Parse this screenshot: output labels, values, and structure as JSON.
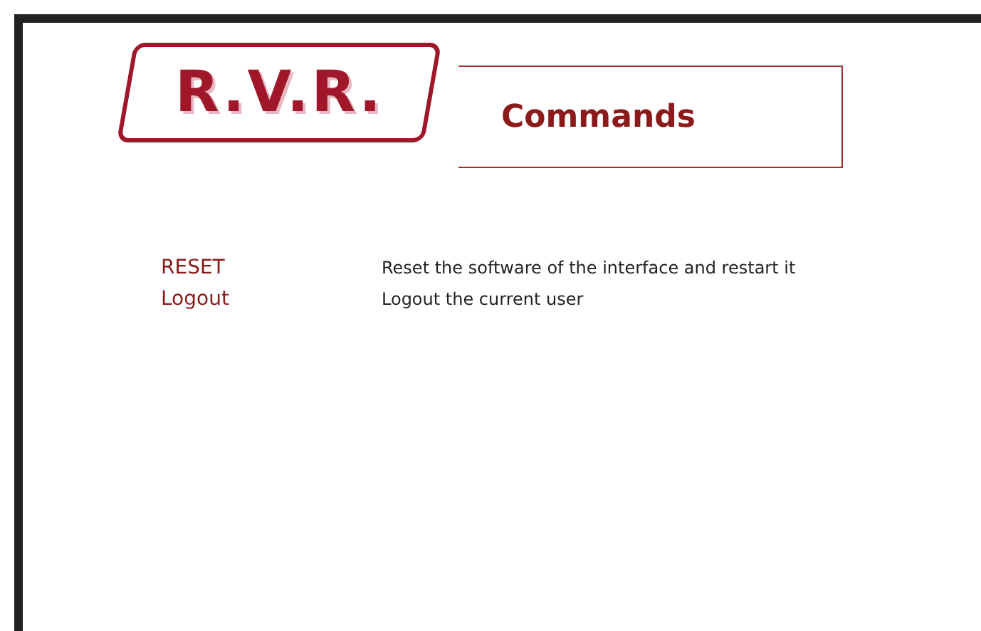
{
  "logo": {
    "text": "R.V.R."
  },
  "header": {
    "title": "Commands"
  },
  "commands": [
    {
      "label": "RESET",
      "description": "Reset the software of the interface and restart it"
    },
    {
      "label": "Logout",
      "description": "Logout the current user"
    }
  ]
}
